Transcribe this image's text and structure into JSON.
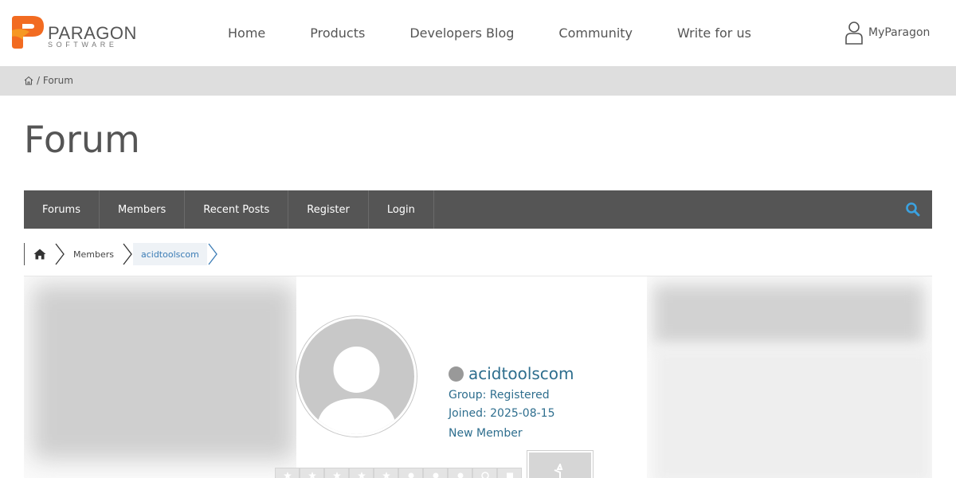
{
  "header": {
    "logo": {
      "word": "PARAGON",
      "sub": "SOFTWARE",
      "mark_color": "#f26b21"
    },
    "nav": [
      {
        "label": "Home"
      },
      {
        "label": "Products"
      },
      {
        "label": "Developers Blog"
      },
      {
        "label": "Community"
      },
      {
        "label": "Write for us"
      }
    ],
    "account": {
      "label": "MyParagon",
      "icon": "user-icon"
    }
  },
  "breadcrumb_bar": {
    "home_icon": "home-icon",
    "text": "/ Forum"
  },
  "page": {
    "title": "Forum"
  },
  "forum_nav": {
    "items": [
      {
        "label": "Forums"
      },
      {
        "label": "Members"
      },
      {
        "label": "Recent Posts"
      },
      {
        "label": "Register"
      },
      {
        "label": "Login"
      }
    ],
    "search_icon": "search-icon",
    "accent": "#3ba2e0"
  },
  "forum_crumbs": {
    "home_icon": "home-icon",
    "items": [
      {
        "label": "Members"
      },
      {
        "label": "acidtoolscom"
      }
    ]
  },
  "profile": {
    "name": "acidtoolscom",
    "status": "offline",
    "group": "Group: Registered",
    "joined": "Joined: 2025-08-15",
    "rank": "New Member",
    "name_color": "#2e6e8e"
  }
}
